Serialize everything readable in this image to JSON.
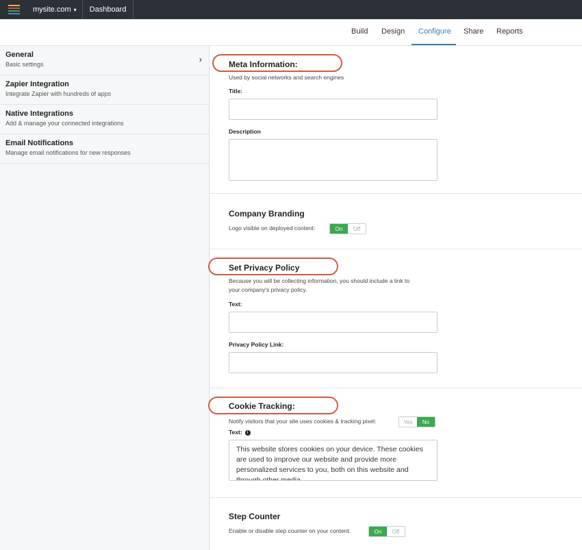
{
  "topbar": {
    "logo_colors": [
      "#e8b443",
      "#d1503c",
      "#3f9f56",
      "#4a87c7"
    ],
    "site_name": "mysite.com",
    "dashboard_label": "Dashboard"
  },
  "tabs": [
    {
      "label": "Build"
    },
    {
      "label": "Design"
    },
    {
      "label": "Configure"
    },
    {
      "label": "Share"
    },
    {
      "label": "Reports"
    }
  ],
  "active_tab": "Configure",
  "sidebar": {
    "items": [
      {
        "title": "General",
        "subtitle": "Basic settings"
      },
      {
        "title": "Zapier Integration",
        "subtitle": "Integrate Zapier with hundreds of apps"
      },
      {
        "title": "Native Integrations",
        "subtitle": "Add & manage your connected integrations"
      },
      {
        "title": "Email Notifications",
        "subtitle": "Manage email notifications for new responses"
      }
    ]
  },
  "meta": {
    "title": "Meta Information:",
    "description": "Used by social networks and search engines",
    "title_label": "Title:",
    "title_value": "",
    "description_label": "Description",
    "description_value": ""
  },
  "branding": {
    "title": "Company Branding",
    "toggle_label": "Logo visible on deployed content:",
    "on": "On",
    "off": "Off"
  },
  "privacy": {
    "title": "Set Privacy Policy",
    "description_line1": "Because you will be collecting information, you should include a link to",
    "description_line2": "your company's privacy policy.",
    "text_label": "Text:",
    "text_value": "",
    "link_label": "Privacy Policy Link:",
    "link_value": ""
  },
  "cookie": {
    "title": "Cookie Tracking:",
    "toggle_label": "Notify visitors that your site uses cookies & tracking pixel:",
    "yes": "Yes",
    "no": "No",
    "text_label": "Text:",
    "text_value": "This website stores cookies on your device. These cookies are used to improve our website and provide more personalized services to you, both on this website and through other media."
  },
  "step_counter": {
    "title": "Step Counter",
    "toggle_label": "Enable or disable step counter on your content:",
    "on": "On",
    "off": "Off"
  },
  "colors": {
    "accent": "#3a7cb8",
    "toggle_on": "#3aaa4e",
    "highlight_circle": "#d35a3f",
    "topbar": "#2c3037"
  }
}
